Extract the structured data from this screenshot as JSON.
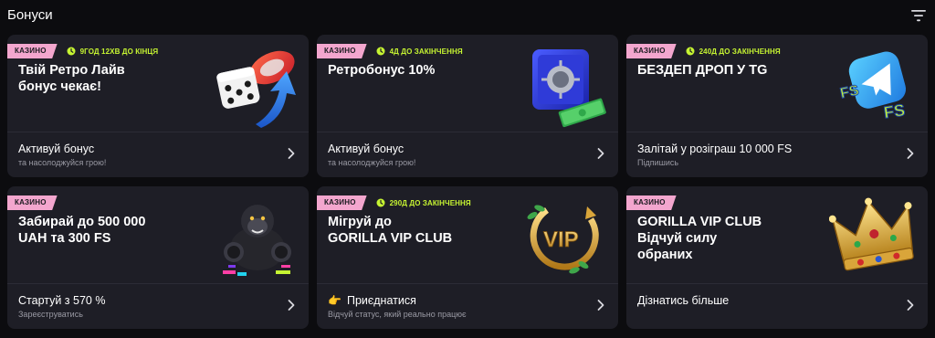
{
  "header": {
    "title": "Бонуси",
    "filter_icon": "filter-icon"
  },
  "colors": {
    "badge": "#f3a6ce",
    "timer": "#c6f432",
    "card_bg": "#1e1e26",
    "page_bg": "#0c0c0f"
  },
  "cards": [
    {
      "badge": "КАЗИНО",
      "timer": "9ГОД 12ХВ ДО КІНЦЯ",
      "title_lines": [
        "Твій Ретро Лайв",
        "бонус чекає!"
      ],
      "art": "dice-and-chip-icon",
      "action": "Активуй бонус",
      "subtitle": "та насолоджуйся грою!"
    },
    {
      "badge": "КАЗИНО",
      "timer": "4Д ДО ЗАКІНЧЕННЯ",
      "title_lines": [
        "Ретробонус 10%"
      ],
      "art": "safe-and-cash-icon",
      "action": "Активуй бонус",
      "subtitle": "та насолоджуйся грою!"
    },
    {
      "badge": "КАЗИНО",
      "timer": "240Д ДО ЗАКІНЧЕННЯ",
      "title_lines": [
        "БЕЗДЕП ДРОП У TG"
      ],
      "art": "telegram-fs-icon",
      "action": "Залітай у розіграш 10 000 FS",
      "subtitle": "Підпишись"
    },
    {
      "badge": "КАЗИНО",
      "timer": "",
      "title_lines": [
        "Забирай до 500 000",
        "UAH та 300 FS"
      ],
      "art": "gorilla-icon",
      "action": "Стартуй з 570 %",
      "subtitle": "Зареєструватись"
    },
    {
      "badge": "КАЗИНО",
      "timer": "290Д ДО ЗАКІНЧЕННЯ",
      "title_lines": [
        "Мігруй до",
        "GORILLA VIP CLUB"
      ],
      "art": "vip-laurel-icon",
      "action_emoji": "👉",
      "action": "Приєднатися",
      "subtitle": "Відчуй статус, який реально працює"
    },
    {
      "badge": "КАЗИНО",
      "timer": "",
      "title_lines": [
        "GORILLA VIP CLUB",
        "Відчуй силу",
        "обраних"
      ],
      "art": "crown-icon",
      "action": "Дізнатись більше",
      "subtitle": ""
    }
  ]
}
